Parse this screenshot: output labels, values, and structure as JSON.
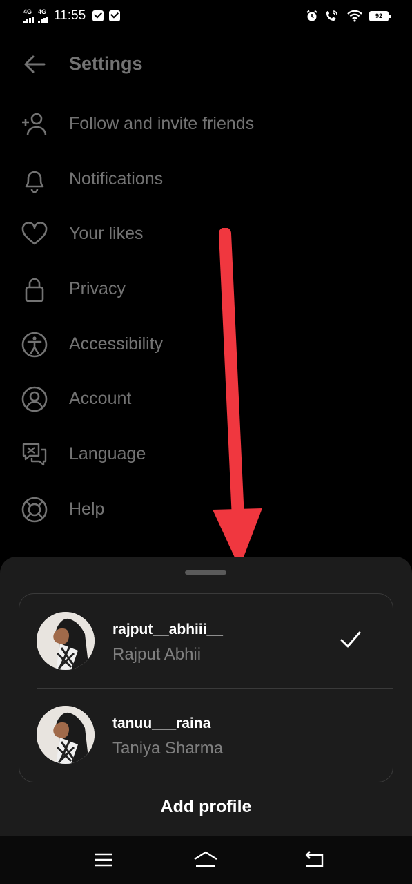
{
  "status_bar": {
    "network_1": "4G",
    "network_2": "4G",
    "time": "11:55",
    "battery": "92"
  },
  "header": {
    "title": "Settings"
  },
  "menu": {
    "items": [
      {
        "label": "Follow and invite friends",
        "icon": "add-person-icon"
      },
      {
        "label": "Notifications",
        "icon": "bell-icon"
      },
      {
        "label": "Your likes",
        "icon": "heart-icon"
      },
      {
        "label": "Privacy",
        "icon": "lock-icon"
      },
      {
        "label": "Accessibility",
        "icon": "accessibility-icon"
      },
      {
        "label": "Account",
        "icon": "account-icon"
      },
      {
        "label": "Language",
        "icon": "language-icon"
      },
      {
        "label": "Help",
        "icon": "lifebuoy-icon"
      }
    ]
  },
  "sheet": {
    "accounts": [
      {
        "username": "rajput__abhiii__",
        "name": "Rajput Abhii",
        "selected": true
      },
      {
        "username": "tanuu___raina",
        "name": "Taniya Sharma",
        "selected": false
      }
    ],
    "add_profile": "Add profile"
  },
  "colors": {
    "background": "#000000",
    "sheet": "#1c1c1c",
    "annotation_arrow": "#f0373f",
    "secondary_text": "#7f7f7f"
  }
}
